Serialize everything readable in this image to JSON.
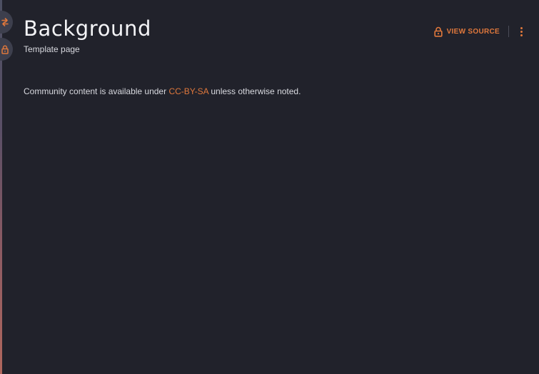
{
  "page": {
    "title": "Background",
    "subtitle": "Template page"
  },
  "actions": {
    "view_source_label": "VIEW SOURCE",
    "view_source_icon": "lock-icon",
    "more_icon": "more-vertical-icon"
  },
  "side_rail": {
    "items": [
      {
        "icon": "exchange-icon"
      },
      {
        "icon": "lock-icon"
      }
    ]
  },
  "footer": {
    "license_prefix": "Community content is available under ",
    "license_link": "CC-BY-SA",
    "license_suffix": " unless otherwise noted."
  },
  "colors": {
    "background": "#21222b",
    "accent": "#e0783c",
    "text": "#d8d9df",
    "side_button": "#3d3f4d"
  }
}
